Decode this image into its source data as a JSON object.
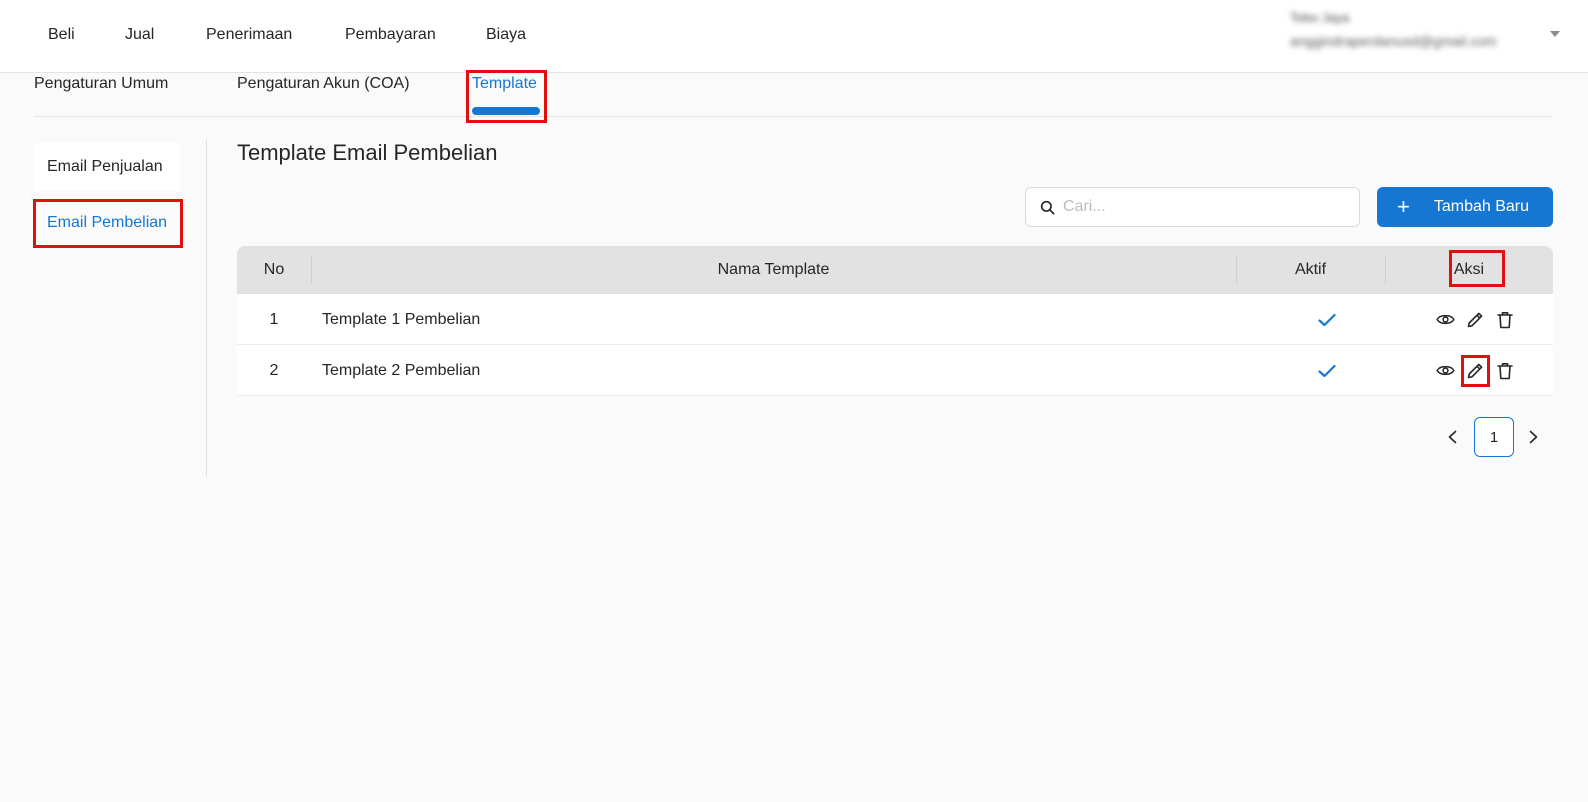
{
  "topnav": {
    "items": [
      "Beli",
      "Jual",
      "Penerimaan",
      "Pembayaran",
      "Biaya"
    ]
  },
  "user": {
    "name": "Tobo Jaya",
    "email": "anggindraperdanusd@gmail.com"
  },
  "settings_tabs": {
    "items": [
      "Pengaturan Umum",
      "Pengaturan Akun (COA)",
      "Template"
    ],
    "active": "Template"
  },
  "subnav": {
    "items": [
      "Email Penjualan",
      "Email Pembelian"
    ],
    "active": "Email Pembelian"
  },
  "page": {
    "title": "Template Email Pembelian"
  },
  "search": {
    "placeholder": "Cari...",
    "value": ""
  },
  "add_button": {
    "label": "Tambah Baru"
  },
  "table": {
    "headers": [
      "No",
      "Nama Template",
      "Aktif",
      "Aksi"
    ],
    "rows": [
      {
        "no": "1",
        "name": "Template 1 Pembelian",
        "aktif": true
      },
      {
        "no": "2",
        "name": "Template 2 Pembelian",
        "aktif": true
      }
    ]
  },
  "pagination": {
    "current": "1"
  },
  "colors": {
    "accent": "#1677d2",
    "highlight": "#e01010"
  }
}
